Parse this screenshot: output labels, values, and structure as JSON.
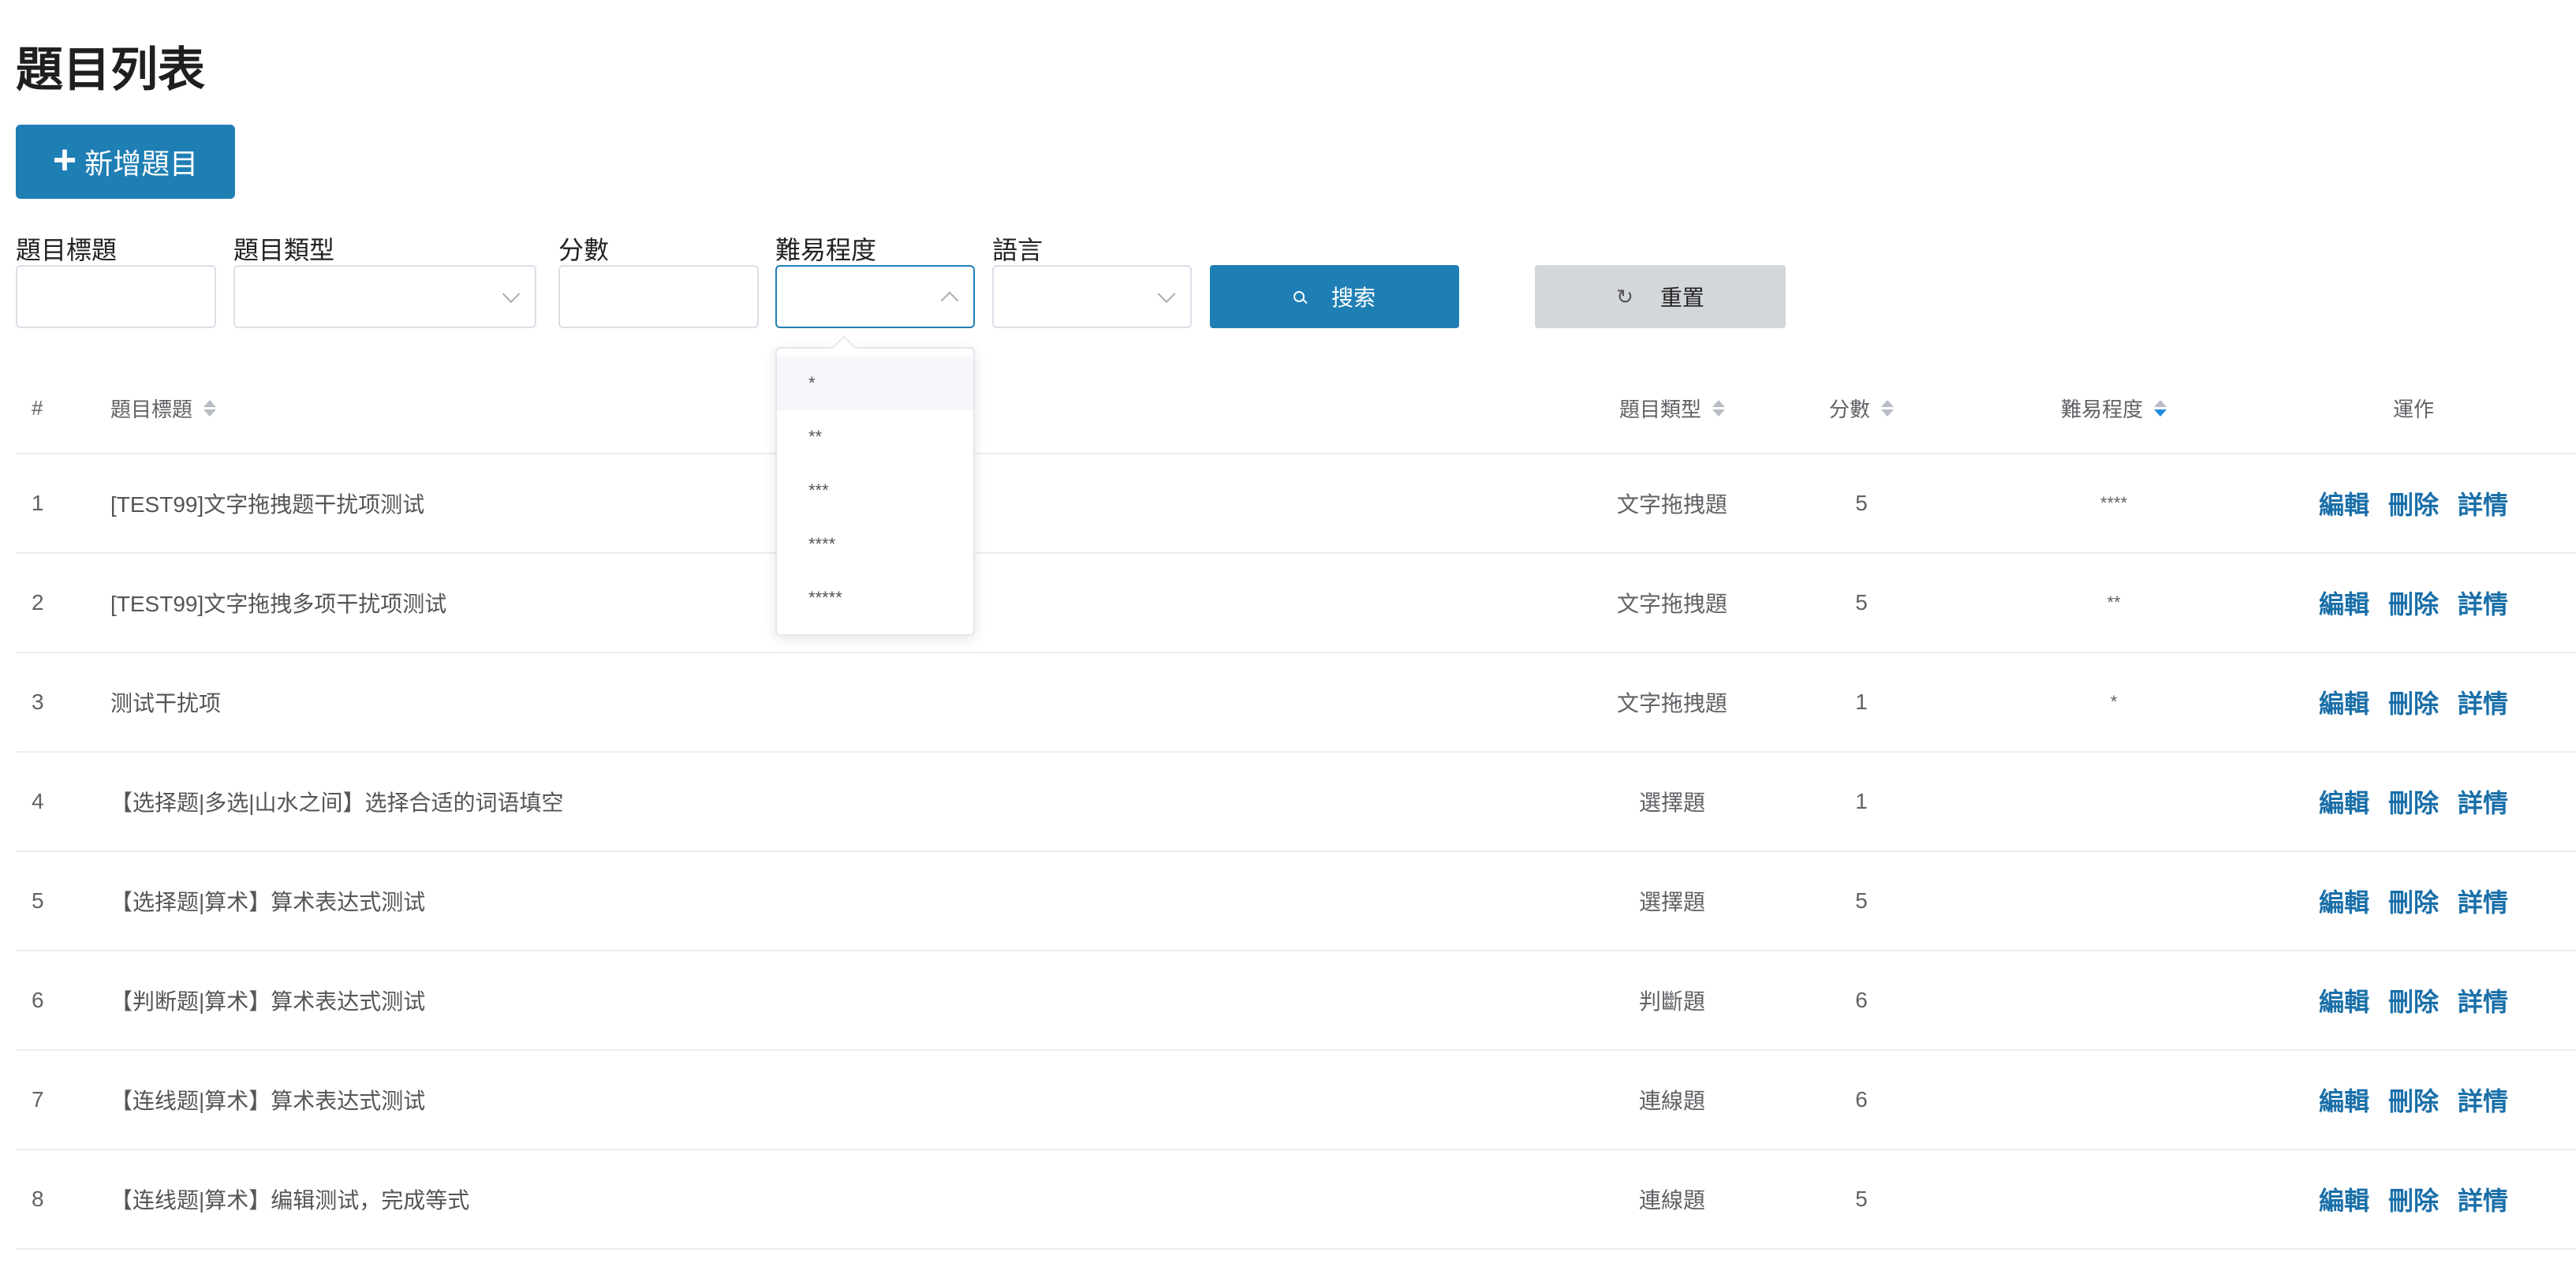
{
  "page": {
    "title": "題目列表"
  },
  "toolbar": {
    "add_label": "新增題目"
  },
  "filters": {
    "title_label": "題目標題",
    "type_label": "題目類型",
    "score_label": "分數",
    "difficulty_label": "難易程度",
    "language_label": "語言",
    "search_label": "搜索",
    "reset_label": "重置"
  },
  "difficulty_dropdown": {
    "options": [
      "*",
      "**",
      "***",
      "****",
      "*****"
    ],
    "hovered_index": 0
  },
  "table": {
    "headers": {
      "index": "#",
      "title": "題目標題",
      "type": "題目類型",
      "score": "分數",
      "difficulty": "難易程度",
      "actions": "運作"
    },
    "action_labels": {
      "edit": "編輯",
      "delete": "刪除",
      "detail": "詳情"
    },
    "rows": [
      {
        "index": "1",
        "title": "[TEST99]文字拖拽题干扰项测试",
        "type": "文字拖拽題",
        "score": "5",
        "difficulty": "****"
      },
      {
        "index": "2",
        "title": "[TEST99]文字拖拽多项干扰项测试",
        "type": "文字拖拽題",
        "score": "5",
        "difficulty": "**"
      },
      {
        "index": "3",
        "title": "测试干扰项",
        "type": "文字拖拽題",
        "score": "1",
        "difficulty": "*"
      },
      {
        "index": "4",
        "title": "【选择题|多选|山水之间】选择合适的词语填空",
        "type": "選擇題",
        "score": "1",
        "difficulty": ""
      },
      {
        "index": "5",
        "title": "【选择题|算术】算术表达式测试",
        "type": "選擇題",
        "score": "5",
        "difficulty": ""
      },
      {
        "index": "6",
        "title": "【判断题|算术】算术表达式测试",
        "type": "判斷題",
        "score": "6",
        "difficulty": ""
      },
      {
        "index": "7",
        "title": "【连线题|算术】算术表达式测试",
        "type": "連線題",
        "score": "6",
        "difficulty": ""
      },
      {
        "index": "8",
        "title": "【连线题|算术】编辑测试，完成等式",
        "type": "連線題",
        "score": "5",
        "difficulty": ""
      }
    ]
  },
  "colors": {
    "primary": "#1f7fb5",
    "link": "#1a6fa8",
    "sort_active": "#1f8ce0"
  }
}
